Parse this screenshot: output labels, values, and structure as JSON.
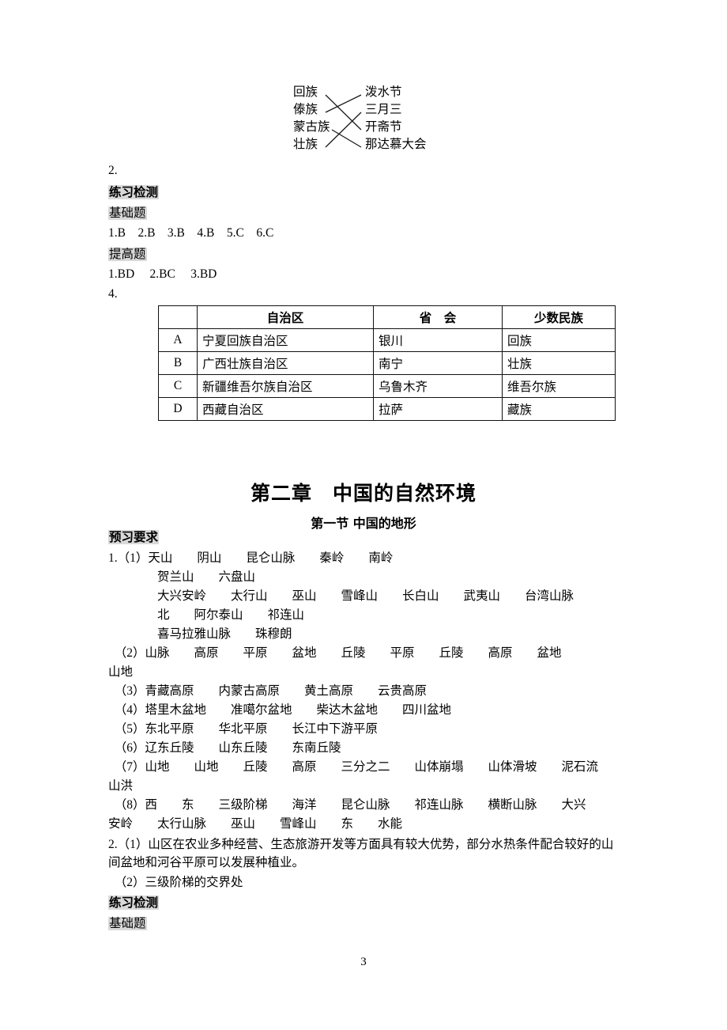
{
  "document": {
    "page_number": "3"
  },
  "match_exercise": {
    "left_items": [
      "回族",
      "傣族",
      "蒙古族",
      "壮族"
    ],
    "right_items": [
      "泼水节",
      "三月三",
      "开斋节",
      "那达慕大会"
    ],
    "connections": [
      {
        "from": 0,
        "to": 2
      },
      {
        "from": 1,
        "to": 0
      },
      {
        "from": 2,
        "to": 3
      },
      {
        "from": 3,
        "to": 1
      }
    ]
  },
  "answers_section_1": {
    "item_2_label": "2.",
    "exercise_header": "练习检测",
    "basic_header": "基础题",
    "basic_answers": "1.B    2.B    3.B    4.B    5.C    6.C",
    "advanced_header": "提高题",
    "advanced_answers": "1.BD     2.BC     3.BD",
    "item_4_label": "4."
  },
  "region_table": {
    "headers": [
      "",
      "自治区",
      "省　会",
      "少数民族"
    ],
    "rows": [
      {
        "key": "A",
        "region": "宁夏回族自治区",
        "capital": "银川",
        "ethnic": "回族"
      },
      {
        "key": "B",
        "region": "广西壮族自治区",
        "capital": "南宁",
        "ethnic": "壮族"
      },
      {
        "key": "C",
        "region": "新疆维吾尔族自治区",
        "capital": "乌鲁木齐",
        "ethnic": "维吾尔族"
      },
      {
        "key": "D",
        "region": "西藏自治区",
        "capital": "拉萨",
        "ethnic": "藏族"
      }
    ]
  },
  "chapter": {
    "title": "第二章　中国的自然环境",
    "section_title": "第一节 中国的地形"
  },
  "preview": {
    "header": "预习要求",
    "lines": [
      "1.（1）天山　　阴山　　昆仑山脉　　秦岭　　南岭",
      "　　　　贺兰山　　六盘山",
      "　　　　大兴安岭　　太行山　　巫山　　雪峰山　　长白山　　武夷山　　台湾山脉",
      "　　　　北　　阿尔泰山　　祁连山",
      "　　　　喜马拉雅山脉　　珠穆朗",
      "　（2）山脉　　高原　　平原　　盆地　　丘陵　　平原　　丘陵　　高原　　盆地",
      "山地",
      "　（3）青藏高原　　内蒙古高原　　黄土高原　　云贵高原",
      "　（4）塔里木盆地　　准噶尔盆地　　柴达木盆地　　四川盆地",
      "　（5）东北平原　　华北平原　　长江中下游平原",
      "　（6）辽东丘陵　　山东丘陵　　东南丘陵",
      "　（7）山地　　山地　　丘陵　　高原　　三分之二　　山体崩塌　　山体滑坡　　泥石流",
      "山洪",
      "　（8）西　　东　　三级阶梯　　海洋　　昆仑山脉　　祁连山脉　　横断山脉　　大兴",
      "安岭　　太行山脉　　巫山　　雪峰山　　东　　水能"
    ],
    "paragraph_2_1": "2.（1）山区在农业多种经营、生态旅游开发等方面具有较大优势，部分水热条件配合较好的山间盆地和河谷平原可以发展种植业。",
    "paragraph_2_2": "　（2）三级阶梯的交界处"
  },
  "answers_section_2": {
    "exercise_header": "练习检测",
    "basic_header": "基础题"
  }
}
